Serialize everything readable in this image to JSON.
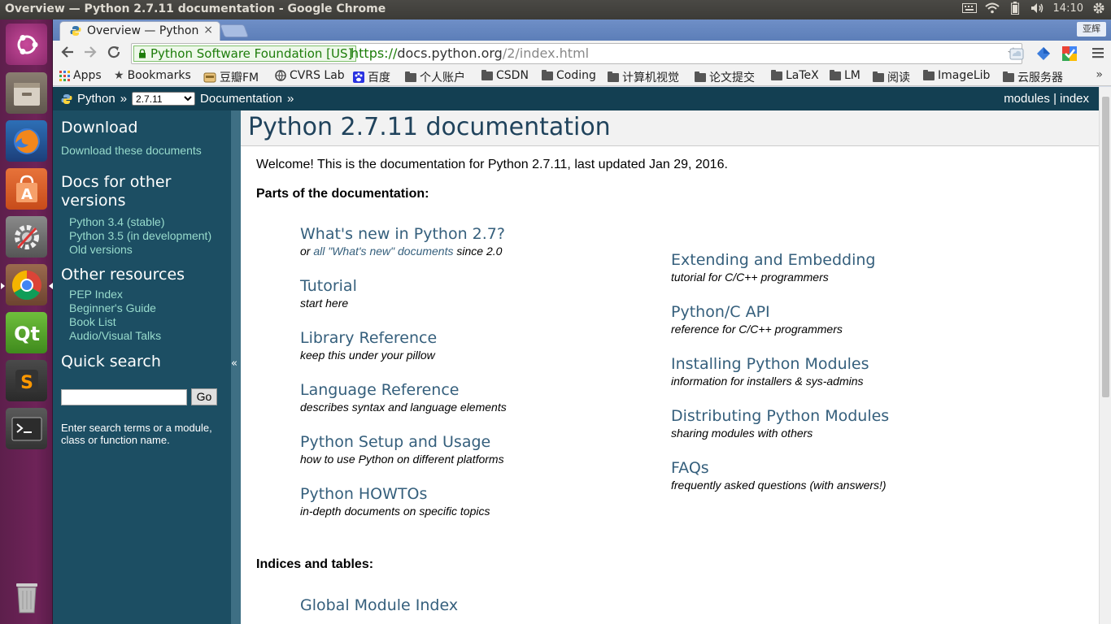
{
  "system": {
    "window_title": "Overview — Python 2.7.11 documentation - Google Chrome",
    "clock": "14:10",
    "user": "亚辉"
  },
  "browser": {
    "tab_title": "Overview — Python",
    "tab_close": "×",
    "ev_label": "Python Software Foundation [US]",
    "url_proto": "https://",
    "url_host": "docs.python.org",
    "url_path": "/2/index.html",
    "bookmarks": [
      "Apps",
      "Bookmarks",
      "豆瓣FM",
      "CVRS Lab",
      "百度",
      "个人账户",
      "CSDN",
      "Coding",
      "计算机视觉",
      "论文提交",
      "LaTeX",
      "LM",
      "阅读",
      "ImageLib",
      "云服务器"
    ],
    "bookmarks_more": "»"
  },
  "relbar": {
    "python": "Python",
    "sep": "»",
    "version": "2.7.11",
    "documentation": "Documentation",
    "modules": "modules",
    "pipe": "|",
    "index": "index"
  },
  "sidebar": {
    "download_heading": "Download",
    "download_link": "Download these documents",
    "other_versions_heading_1": "Docs for other",
    "other_versions_heading_2": "versions",
    "versions": [
      "Python 3.4 (stable)",
      "Python 3.5 (in development)",
      "Old versions"
    ],
    "other_resources_heading": "Other resources",
    "resources": [
      "PEP Index",
      "Beginner's Guide",
      "Book List",
      "Audio/Visual Talks"
    ],
    "quick_search_heading": "Quick search",
    "go_label": "Go",
    "search_hint": "Enter search terms or a module, class or function name.",
    "collapse": "«"
  },
  "content": {
    "title": "Python 2.7.11 documentation",
    "welcome": "Welcome! This is the documentation for Python 2.7.11, last updated Jan 29, 2016.",
    "parts_heading": "Parts of the documentation:",
    "whatsnew_title": "What's new in Python 2.7?",
    "whatsnew_or": "or ",
    "whatsnew_link": "all \"What's new\" documents",
    "whatsnew_since": " since 2.0",
    "left_docs": [
      {
        "title": "Tutorial",
        "desc": "start here"
      },
      {
        "title": "Library Reference",
        "desc": "keep this under your pillow"
      },
      {
        "title": "Language Reference",
        "desc": "describes syntax and language elements"
      },
      {
        "title": "Python Setup and Usage",
        "desc": "how to use Python on different platforms"
      },
      {
        "title": "Python HOWTOs",
        "desc": "in-depth documents on specific topics"
      }
    ],
    "right_docs": [
      {
        "title": "Extending and Embedding",
        "desc": "tutorial for C/C++ programmers"
      },
      {
        "title": "Python/C API",
        "desc": "reference for C/C++ programmers"
      },
      {
        "title": "Installing Python Modules",
        "desc": "information for installers & sys-admins"
      },
      {
        "title": "Distributing Python Modules",
        "desc": "sharing modules with others"
      },
      {
        "title": "FAQs",
        "desc": "frequently asked questions (with answers!)"
      }
    ],
    "indices_heading": "Indices and tables:",
    "global_module_index": "Global Module Index"
  }
}
